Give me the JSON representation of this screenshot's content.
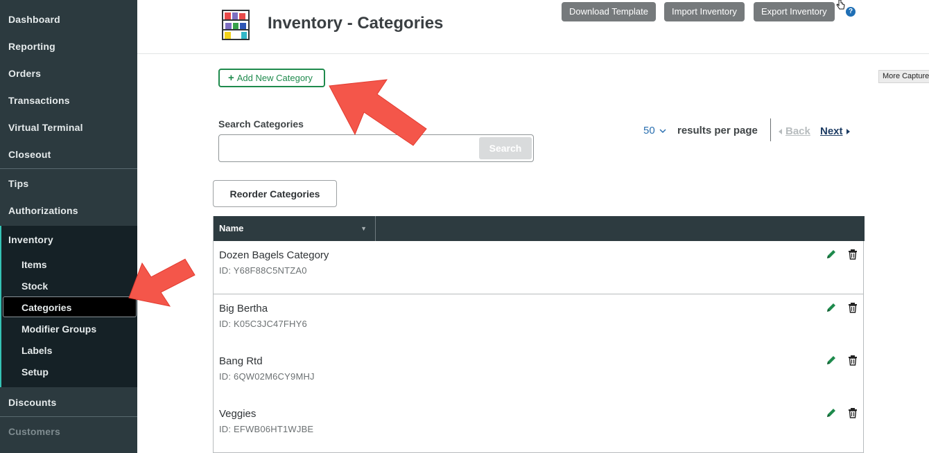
{
  "sidebar": {
    "items": [
      {
        "label": "Dashboard"
      },
      {
        "label": "Reporting"
      },
      {
        "label": "Orders"
      },
      {
        "label": "Transactions"
      },
      {
        "label": "Virtual Terminal"
      },
      {
        "label": "Closeout"
      },
      {
        "label": "Tips"
      },
      {
        "label": "Authorizations"
      },
      {
        "label": "Inventory"
      },
      {
        "label": "Discounts"
      },
      {
        "label": "Customers"
      }
    ],
    "inventory_sub": [
      {
        "label": "Items"
      },
      {
        "label": "Stock"
      },
      {
        "label": "Categories",
        "active": true
      },
      {
        "label": "Modifier Groups"
      },
      {
        "label": "Labels"
      },
      {
        "label": "Setup"
      }
    ]
  },
  "header": {
    "title": "Inventory - Categories",
    "buttons": {
      "download": "Download Template",
      "import": "Import Inventory",
      "export": "Export Inventory"
    },
    "help": "?"
  },
  "more_capture": "More Capture",
  "add_button": {
    "icon": "plus-icon",
    "label": "Add New Category"
  },
  "search": {
    "label": "Search Categories",
    "value": "",
    "placeholder": "",
    "button": "Search"
  },
  "pagination": {
    "per_page_value": "50",
    "per_page_label": "results per page",
    "back": "Back",
    "next": "Next"
  },
  "reorder_button": "Reorder Categories",
  "table": {
    "column": "Name",
    "rows": [
      {
        "name": "Dozen Bagels Category",
        "id": "ID: Y68F88C5NTZA0"
      },
      {
        "name": "Big Bertha",
        "id": "ID: K05C3JC47FHY6"
      },
      {
        "name": "Bang Rtd",
        "id": "ID: 6QW02M6CY9MHJ"
      },
      {
        "name": "Veggies",
        "id": "ID: EFWB06HT1WJBE"
      }
    ]
  },
  "colors": {
    "sidebar_bg": "#2c3a3f",
    "accent_green": "#1e8a4c",
    "annotation_arrow": "#f4564a",
    "link_blue": "#2a6fb0"
  }
}
